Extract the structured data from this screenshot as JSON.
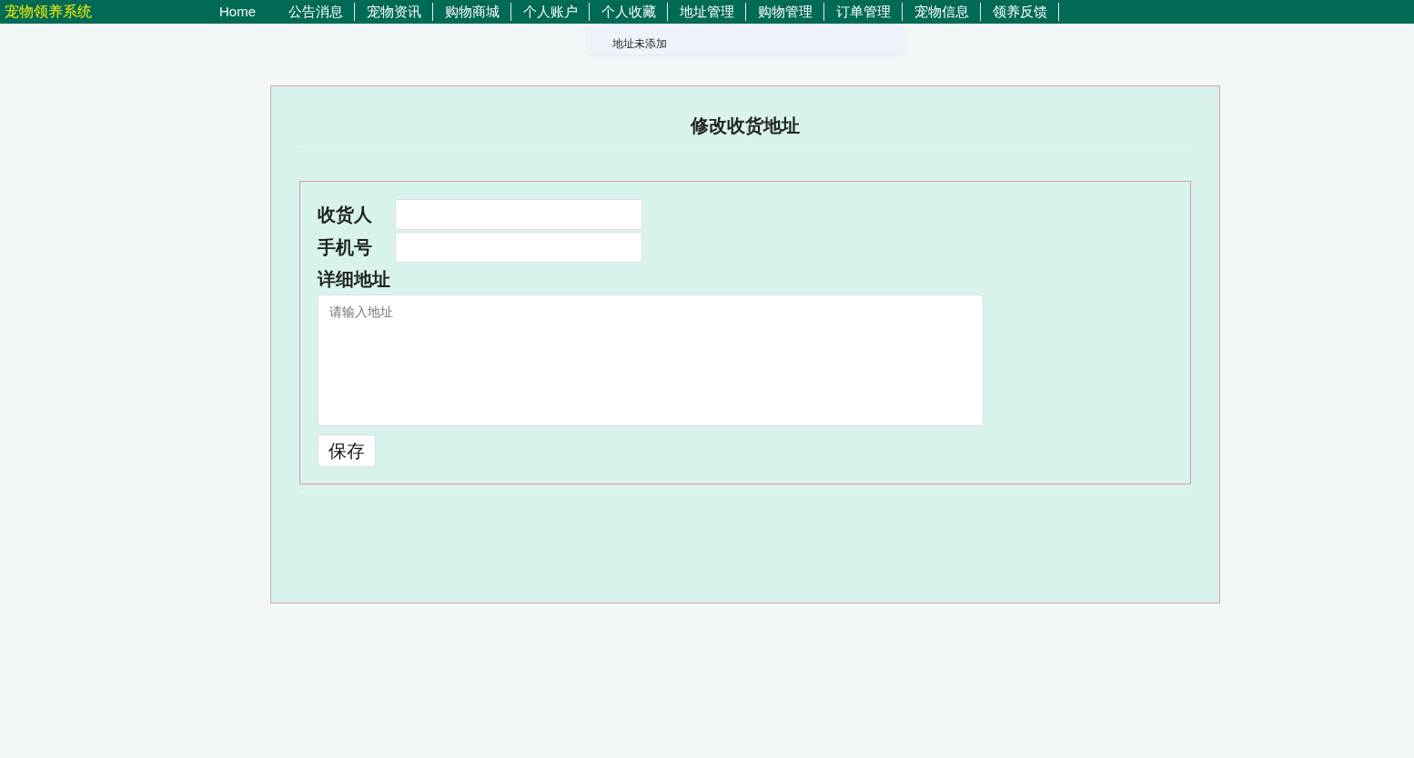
{
  "brand": "宠物领养系统",
  "nav": [
    {
      "label": "Home"
    },
    {
      "label": "公告消息"
    },
    {
      "label": "宠物资讯"
    },
    {
      "label": "购物商城"
    },
    {
      "label": "个人账户"
    },
    {
      "label": "个人收藏"
    },
    {
      "label": "地址管理"
    },
    {
      "label": "购物管理"
    },
    {
      "label": "订单管理"
    },
    {
      "label": "宠物信息"
    },
    {
      "label": "领养反馈"
    }
  ],
  "toast": {
    "message": "地址未添加"
  },
  "form": {
    "title": "修改收货地址",
    "fields": [
      {
        "label": "收货人",
        "kind": "input"
      },
      {
        "label": "手机号",
        "kind": "input"
      },
      {
        "label": "详细地址",
        "kind": "textarea",
        "placeholder": "请输入地址"
      }
    ],
    "submit": "保存"
  }
}
